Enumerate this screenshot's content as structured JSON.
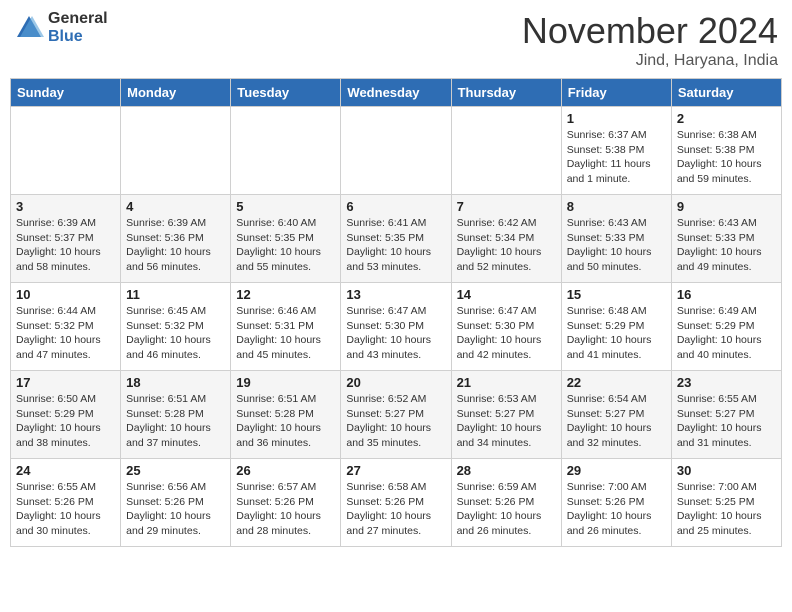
{
  "header": {
    "logo_general": "General",
    "logo_blue": "Blue",
    "month_title": "November 2024",
    "location": "Jind, Haryana, India"
  },
  "weekdays": [
    "Sunday",
    "Monday",
    "Tuesday",
    "Wednesday",
    "Thursday",
    "Friday",
    "Saturday"
  ],
  "weeks": [
    [
      {
        "day": "",
        "info": ""
      },
      {
        "day": "",
        "info": ""
      },
      {
        "day": "",
        "info": ""
      },
      {
        "day": "",
        "info": ""
      },
      {
        "day": "",
        "info": ""
      },
      {
        "day": "1",
        "info": "Sunrise: 6:37 AM\nSunset: 5:38 PM\nDaylight: 11 hours and 1 minute."
      },
      {
        "day": "2",
        "info": "Sunrise: 6:38 AM\nSunset: 5:38 PM\nDaylight: 10 hours and 59 minutes."
      }
    ],
    [
      {
        "day": "3",
        "info": "Sunrise: 6:39 AM\nSunset: 5:37 PM\nDaylight: 10 hours and 58 minutes."
      },
      {
        "day": "4",
        "info": "Sunrise: 6:39 AM\nSunset: 5:36 PM\nDaylight: 10 hours and 56 minutes."
      },
      {
        "day": "5",
        "info": "Sunrise: 6:40 AM\nSunset: 5:35 PM\nDaylight: 10 hours and 55 minutes."
      },
      {
        "day": "6",
        "info": "Sunrise: 6:41 AM\nSunset: 5:35 PM\nDaylight: 10 hours and 53 minutes."
      },
      {
        "day": "7",
        "info": "Sunrise: 6:42 AM\nSunset: 5:34 PM\nDaylight: 10 hours and 52 minutes."
      },
      {
        "day": "8",
        "info": "Sunrise: 6:43 AM\nSunset: 5:33 PM\nDaylight: 10 hours and 50 minutes."
      },
      {
        "day": "9",
        "info": "Sunrise: 6:43 AM\nSunset: 5:33 PM\nDaylight: 10 hours and 49 minutes."
      }
    ],
    [
      {
        "day": "10",
        "info": "Sunrise: 6:44 AM\nSunset: 5:32 PM\nDaylight: 10 hours and 47 minutes."
      },
      {
        "day": "11",
        "info": "Sunrise: 6:45 AM\nSunset: 5:32 PM\nDaylight: 10 hours and 46 minutes."
      },
      {
        "day": "12",
        "info": "Sunrise: 6:46 AM\nSunset: 5:31 PM\nDaylight: 10 hours and 45 minutes."
      },
      {
        "day": "13",
        "info": "Sunrise: 6:47 AM\nSunset: 5:30 PM\nDaylight: 10 hours and 43 minutes."
      },
      {
        "day": "14",
        "info": "Sunrise: 6:47 AM\nSunset: 5:30 PM\nDaylight: 10 hours and 42 minutes."
      },
      {
        "day": "15",
        "info": "Sunrise: 6:48 AM\nSunset: 5:29 PM\nDaylight: 10 hours and 41 minutes."
      },
      {
        "day": "16",
        "info": "Sunrise: 6:49 AM\nSunset: 5:29 PM\nDaylight: 10 hours and 40 minutes."
      }
    ],
    [
      {
        "day": "17",
        "info": "Sunrise: 6:50 AM\nSunset: 5:29 PM\nDaylight: 10 hours and 38 minutes."
      },
      {
        "day": "18",
        "info": "Sunrise: 6:51 AM\nSunset: 5:28 PM\nDaylight: 10 hours and 37 minutes."
      },
      {
        "day": "19",
        "info": "Sunrise: 6:51 AM\nSunset: 5:28 PM\nDaylight: 10 hours and 36 minutes."
      },
      {
        "day": "20",
        "info": "Sunrise: 6:52 AM\nSunset: 5:27 PM\nDaylight: 10 hours and 35 minutes."
      },
      {
        "day": "21",
        "info": "Sunrise: 6:53 AM\nSunset: 5:27 PM\nDaylight: 10 hours and 34 minutes."
      },
      {
        "day": "22",
        "info": "Sunrise: 6:54 AM\nSunset: 5:27 PM\nDaylight: 10 hours and 32 minutes."
      },
      {
        "day": "23",
        "info": "Sunrise: 6:55 AM\nSunset: 5:27 PM\nDaylight: 10 hours and 31 minutes."
      }
    ],
    [
      {
        "day": "24",
        "info": "Sunrise: 6:55 AM\nSunset: 5:26 PM\nDaylight: 10 hours and 30 minutes."
      },
      {
        "day": "25",
        "info": "Sunrise: 6:56 AM\nSunset: 5:26 PM\nDaylight: 10 hours and 29 minutes."
      },
      {
        "day": "26",
        "info": "Sunrise: 6:57 AM\nSunset: 5:26 PM\nDaylight: 10 hours and 28 minutes."
      },
      {
        "day": "27",
        "info": "Sunrise: 6:58 AM\nSunset: 5:26 PM\nDaylight: 10 hours and 27 minutes."
      },
      {
        "day": "28",
        "info": "Sunrise: 6:59 AM\nSunset: 5:26 PM\nDaylight: 10 hours and 26 minutes."
      },
      {
        "day": "29",
        "info": "Sunrise: 7:00 AM\nSunset: 5:26 PM\nDaylight: 10 hours and 26 minutes."
      },
      {
        "day": "30",
        "info": "Sunrise: 7:00 AM\nSunset: 5:25 PM\nDaylight: 10 hours and 25 minutes."
      }
    ]
  ]
}
